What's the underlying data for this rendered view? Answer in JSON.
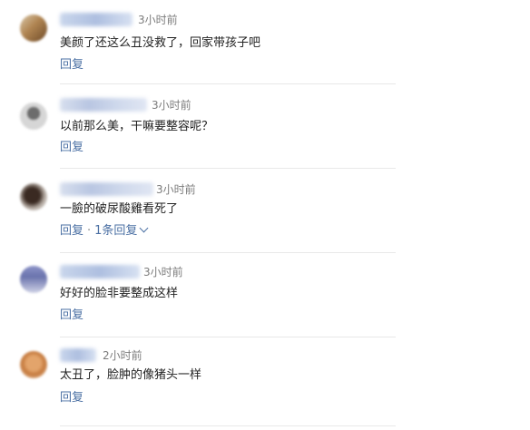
{
  "comments": [
    {
      "time": "3小时前",
      "text": "美颜了还这么丑没救了，回家带孩子吧",
      "reply": "回复"
    },
    {
      "time": "3小时前",
      "text": "以前那么美，干嘛要整容呢？",
      "reply": "回复"
    },
    {
      "time": "3小时前",
      "text": "一臉的破尿酸雞看死了",
      "reply": "回复",
      "separator": "·",
      "replies_count": "1条回复"
    },
    {
      "time": "3小时前",
      "text": "好好的脸非要整成这样",
      "reply": "回复"
    },
    {
      "time": "2小时前",
      "text": "太丑了，脸肿的像猪头一样",
      "reply": "回复"
    }
  ],
  "icons": {
    "expand": "chevron-down-icon"
  }
}
